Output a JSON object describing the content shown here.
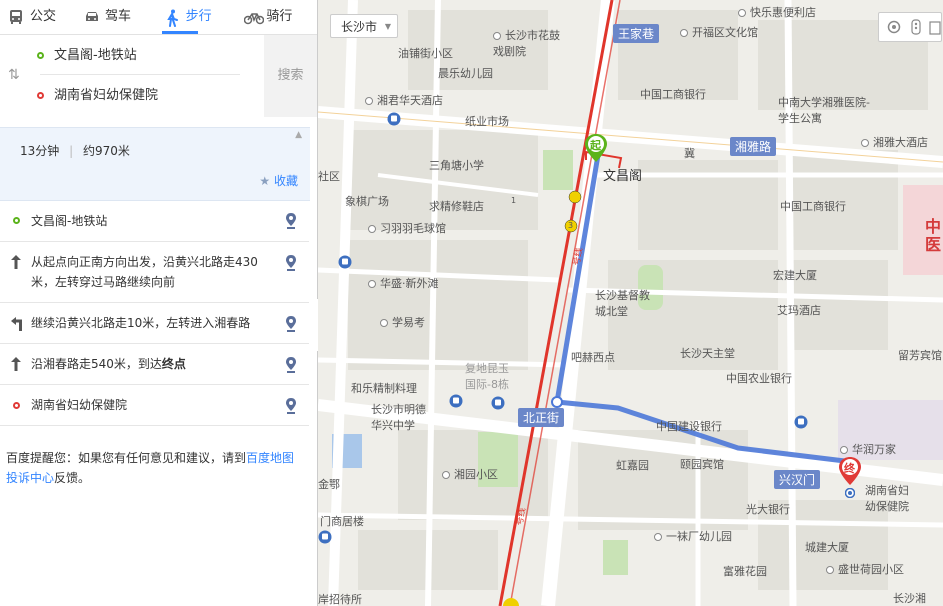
{
  "tabs": [
    {
      "label": "公交",
      "icon": "bus-icon"
    },
    {
      "label": "驾车",
      "icon": "car-icon"
    },
    {
      "label": "步行",
      "icon": "walk-icon",
      "active": true
    },
    {
      "label": "骑行",
      "icon": "bike-icon"
    }
  ],
  "route": {
    "start": "文昌阁-地铁站",
    "end": "湖南省妇幼保健院",
    "search_label": "搜索"
  },
  "summary": {
    "time": "13分钟",
    "sep": "|",
    "distance": "约970米",
    "fav": "收藏"
  },
  "steps": [
    {
      "text": "文昌阁-地铁站",
      "type": "start"
    },
    {
      "text": "从起点向正南方向出发，沿黄兴北路走430米，左转穿过马路继续向前",
      "type": "straight"
    },
    {
      "text": "继续沿黄兴北路走10米，左转进入湘春路",
      "type": "left"
    },
    {
      "text": "沿湘春路走540米，到达",
      "bold": "终点",
      "type": "straight"
    },
    {
      "text": "湖南省妇幼保健院",
      "type": "end"
    }
  ],
  "tip": {
    "prefix": "百度提醒您：如果您有任何意见和建议，请到",
    "link": "百度地图投诉中心",
    "suffix": "反馈。"
  },
  "map": {
    "city": "长沙市",
    "road_tags": [
      "王家巷",
      "湘雅路",
      "北正街",
      "兴汉门"
    ],
    "start_marker": "起",
    "end_marker": "终",
    "pois": [
      "快乐惠便利店",
      "长沙市花鼓戏剧院",
      "油铺街小区",
      "开福区文化馆",
      "晨乐幼儿园",
      "中国工商银行",
      "湘君华天酒店",
      "纸业市场",
      "中南大学湘雅医院-学生公寓",
      "湘雅大酒店",
      "三角塘小学",
      "文昌阁",
      "冀",
      "中国工商银行",
      "象棋广场",
      "求精修鞋店",
      "习羽羽毛球馆",
      "宏建大厦",
      "华盛·新外滩",
      "长沙基督教城北堂",
      "艾玛酒店",
      "学易考",
      "吧赫西点",
      "长沙天主堂",
      "留芳宾馆",
      "复地昆玉国际-8栋",
      "中国农业银行",
      "和乐精制料理",
      "长沙市明德华兴中学",
      "中国建设银行",
      "华润万家",
      "虹嘉园",
      "颐园宾馆",
      "湘园小区",
      "湖南省妇幼保健院",
      "光大银行",
      "门商居楼",
      "一袜厂幼儿园",
      "城建大厦",
      "富雅花园",
      "盛世荷园小区",
      "岸招待所",
      "金鄂",
      "社区",
      "长沙湘"
    ],
    "metro_labels": [
      "1",
      "3",
      "号线",
      "号线"
    ],
    "hospital_tag": "中医"
  },
  "colors": {
    "accent": "#3385ff",
    "route": "#4c78d8",
    "metro": "#e0352b",
    "start": "#5bb31b",
    "end": "#e03a36"
  }
}
